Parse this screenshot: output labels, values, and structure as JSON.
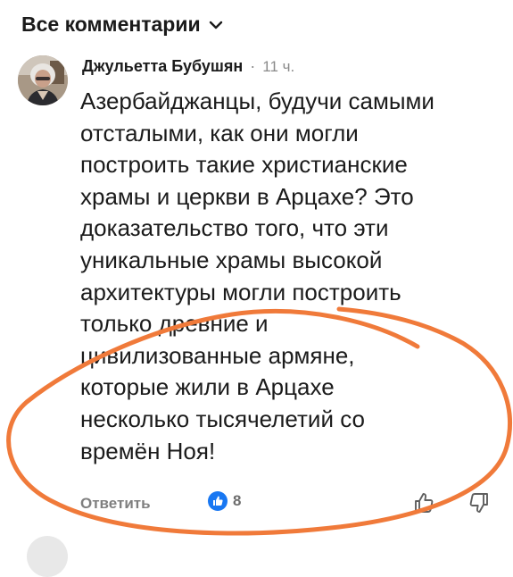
{
  "header": {
    "title": "Все комментарии",
    "chevron_icon": "chevron-down-icon"
  },
  "comment": {
    "author": "Джульетта Бубушян",
    "separator": "·",
    "time": "11 ч.",
    "lines": [
      "Азербайджанцы, будучи самыми",
      "отсталыми,  как они могли",
      "построить такие христианские",
      "храмы и церкви в Арцахе? Это",
      "доказательство того, что эти",
      "уникальные храмы высокой",
      "архитектуры могли построить",
      "только древние и",
      "цивилизованные армяне,",
      "которые жили в Арцахе",
      "несколько тысячелетий со",
      "времён Ноя!"
    ]
  },
  "actions": {
    "reply_label": "Ответить",
    "reaction_icon": "like-icon",
    "reaction_count": "8",
    "like_icon": "thumbs-up-icon",
    "dislike_icon": "thumbs-down-icon"
  },
  "colors": {
    "annotation": "#f07a3a",
    "like_badge": "#1877f2",
    "muted_text": "#7f7f7f"
  }
}
